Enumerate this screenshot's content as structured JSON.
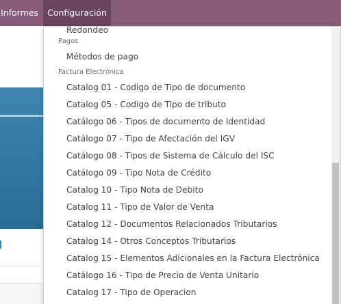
{
  "navbar": {
    "items": [
      {
        "label": "Informes"
      },
      {
        "label": "Configuración"
      }
    ],
    "colors": {
      "bar": "#875a7b",
      "active": "#6a4360"
    }
  },
  "dropdown": {
    "cut_item": "Redondeo",
    "sections": [
      {
        "header": "Pagos",
        "items": [
          "Métodos de pago"
        ]
      },
      {
        "header": "Factura Electrónica",
        "items": [
          "Catalog 01 - Codigo de Tipo de documento",
          "Catalog 05 - Codigo de Tipo de tributo",
          "Catálogo 06 - Tipos de documento de Identidad",
          "Catálogo 07 - Tipo de Afectación del IGV",
          "Catálogo 08 - Tipos de Sistema de Cálculo del ISC",
          "Catálogo 09 - Tipo Nota de Crédito",
          "Catalog 10 - Tipo Nota de Debito",
          "Catalog 11 - Tipo de Valor de Venta",
          "Catalog 12 - Documentos Relacionados Tributarios",
          "Catalog 14 - Otros Conceptos Tributarios",
          "Catalog 15 - Elementos Adicionales en la Factura Electrónica",
          "Catálogo 16 - Tipo de Precio de Venta Unitario",
          "Catalog 17 - Tipo de Operacion"
        ]
      }
    ]
  }
}
